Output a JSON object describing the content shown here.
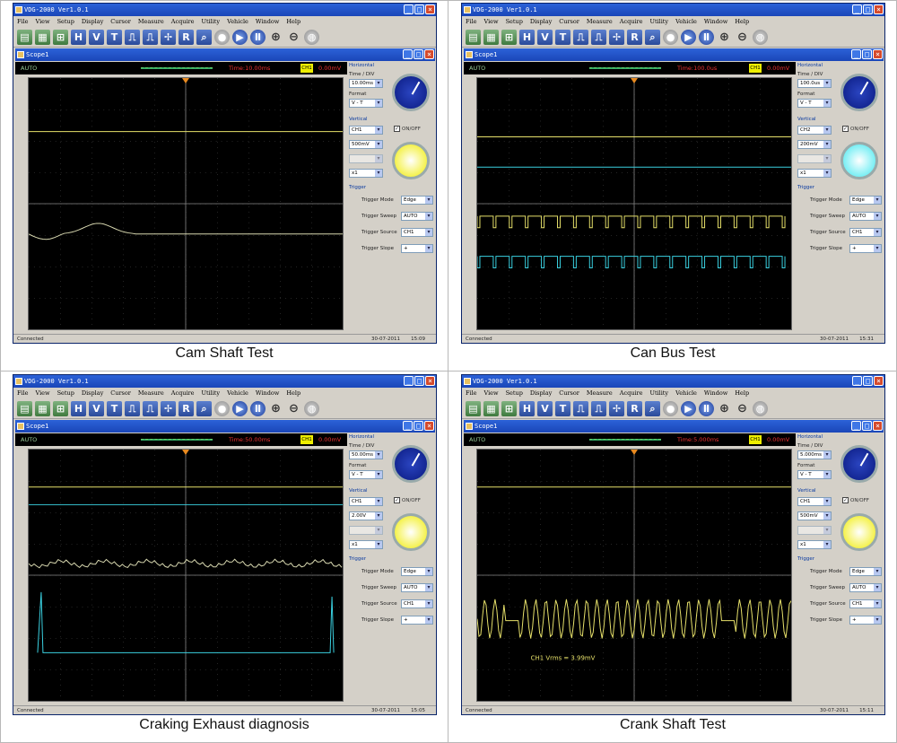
{
  "panels": [
    {
      "caption": "Cam Shaft Test",
      "app_title": "VDG-2000 Ver1.0.1",
      "scope_title": "Scope1",
      "menu": [
        "File",
        "View",
        "Setup",
        "Display",
        "Cursor",
        "Measure",
        "Acquire",
        "Utility",
        "Vehicle",
        "Window",
        "Help"
      ],
      "toolbar": {
        "h": "H",
        "v": "V",
        "t": "T"
      },
      "status": {
        "mode": "AUTO",
        "time": "Time:10.00ms",
        "ch": "CH1",
        "volt": "0.00mV"
      },
      "horizontal": {
        "title": "Horizontal",
        "time_div_label": "Time / DIV",
        "time_div": "10.00ms",
        "format_label": "Format",
        "format": "V - T"
      },
      "vertical": {
        "title": "Vertical",
        "channel": "CH1",
        "onoff": "ON/OFF",
        "volt_div": "500mV",
        "probe": "x1"
      },
      "trigger": {
        "title": "Trigger",
        "mode_label": "Trigger Mode",
        "mode": "Edge",
        "sweep_label": "Trigger Sweep",
        "sweep": "AUTO",
        "source_label": "Trigger Source",
        "source": "CH1",
        "slope_label": "Trigger Slope",
        "slope": "+"
      },
      "statusbar": {
        "left": "Connected",
        "date": "30-07-2011",
        "time": "15:09"
      },
      "colors": {
        "knob_v": "#f0ec00"
      }
    },
    {
      "caption": "Can Bus Test",
      "app_title": "VDG-2000 Ver1.0.1",
      "scope_title": "Scope1",
      "menu": [
        "File",
        "View",
        "Setup",
        "Display",
        "Cursor",
        "Measure",
        "Acquire",
        "Utility",
        "Vehicle",
        "Window",
        "Help"
      ],
      "toolbar": {
        "h": "H",
        "v": "V",
        "t": "T"
      },
      "status": {
        "mode": "AUTO",
        "time": "Time:100.0us",
        "ch": "CH1",
        "volt": "0.00mV"
      },
      "horizontal": {
        "title": "Horizontal",
        "time_div_label": "Time / DIV",
        "time_div": "100.0us",
        "format_label": "Format",
        "format": "V - T"
      },
      "vertical": {
        "title": "Vertical",
        "channel": "CH2",
        "onoff": "ON/OFF",
        "volt_div": "200mV",
        "probe": "x1"
      },
      "trigger": {
        "title": "Trigger",
        "mode_label": "Trigger Mode",
        "mode": "Edge",
        "sweep_label": "Trigger Sweep",
        "sweep": "AUTO",
        "source_label": "Trigger Source",
        "source": "CH1",
        "slope_label": "Trigger Slope",
        "slope": "+"
      },
      "statusbar": {
        "left": "Connected",
        "date": "30-07-2011",
        "time": "15:31"
      },
      "colors": {
        "knob_v": "#40e8f0"
      }
    },
    {
      "caption": "Craking Exhaust diagnosis",
      "app_title": "VDG-2000 Ver1.0.1",
      "scope_title": "Scope1",
      "menu": [
        "File",
        "View",
        "Setup",
        "Display",
        "Cursor",
        "Measure",
        "Acquire",
        "Utility",
        "Vehicle",
        "Window",
        "Help"
      ],
      "toolbar": {
        "h": "H",
        "v": "V",
        "t": "T"
      },
      "status": {
        "mode": "AUTO",
        "time": "Time:50.00ms",
        "ch": "CH1",
        "volt": "0.00mV"
      },
      "horizontal": {
        "title": "Horizontal",
        "time_div_label": "Time / DIV",
        "time_div": "50.00ms",
        "format_label": "Format",
        "format": "V - T"
      },
      "vertical": {
        "title": "Vertical",
        "channel": "CH1",
        "onoff": "ON/OFF",
        "volt_div": "2.00V",
        "probe": "x1"
      },
      "trigger": {
        "title": "Trigger",
        "mode_label": "Trigger Mode",
        "mode": "Edge",
        "sweep_label": "Trigger Sweep",
        "sweep": "AUTO",
        "source_label": "Trigger Source",
        "source": "CH1",
        "slope_label": "Trigger Slope",
        "slope": "+"
      },
      "statusbar": {
        "left": "Connected",
        "date": "30-07-2011",
        "time": "15:05"
      },
      "colors": {
        "knob_v": "#f0ec00"
      }
    },
    {
      "caption": "Crank Shaft Test",
      "app_title": "VDG-2000 Ver1.0.1",
      "scope_title": "Scope1",
      "menu": [
        "File",
        "View",
        "Setup",
        "Display",
        "Cursor",
        "Measure",
        "Acquire",
        "Utility",
        "Vehicle",
        "Window",
        "Help"
      ],
      "toolbar": {
        "h": "H",
        "v": "V",
        "t": "T"
      },
      "status": {
        "mode": "AUTO",
        "time": "Time:5.000ms",
        "ch": "CH1",
        "volt": "0.00mV"
      },
      "horizontal": {
        "title": "Horizontal",
        "time_div_label": "Time / DIV",
        "time_div": "5.000ms",
        "format_label": "Format",
        "format": "V - T"
      },
      "vertical": {
        "title": "Vertical",
        "channel": "CH1",
        "onoff": "ON/OFF",
        "volt_div": "500mV",
        "probe": "x1"
      },
      "trigger": {
        "title": "Trigger",
        "mode_label": "Trigger Mode",
        "mode": "Edge",
        "sweep_label": "Trigger Sweep",
        "sweep": "AUTO",
        "source_label": "Trigger Source",
        "source": "CH1",
        "slope_label": "Trigger Slope",
        "slope": "+"
      },
      "statusbar": {
        "left": "Connected",
        "date": "30-07-2011",
        "time": "15:11"
      },
      "measure": "CH1 Vrms = 3.99mV",
      "colors": {
        "knob_v": "#f0ec00"
      }
    }
  ]
}
